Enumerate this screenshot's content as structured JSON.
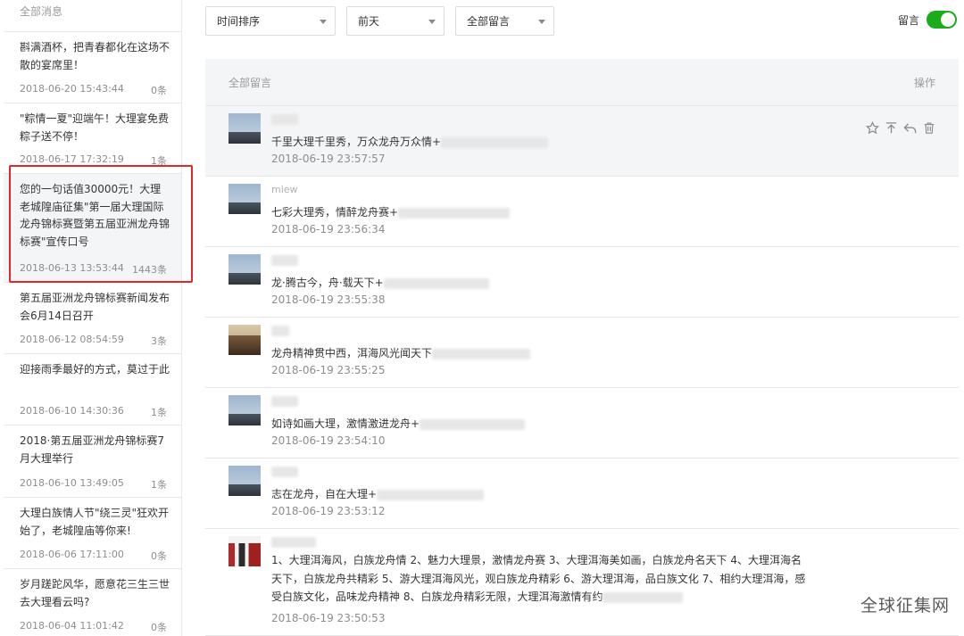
{
  "sidebar": {
    "header": "全部消息",
    "articles": [
      {
        "title": "斟满酒杯，把青春都化在这场不散的宴席里！",
        "date": "2018-06-20 15:43:44",
        "count": "0条"
      },
      {
        "title": "\"粽情一夏\"迎端午！大理宴免费粽子送不停！",
        "date": "2018-06-17 17:32:19",
        "count": "1条"
      },
      {
        "title": "您的一句话值30000元！大理老城隍庙征集\"第一届大理国际龙舟锦标赛暨第五届亚洲龙舟锦标赛\"宣传口号",
        "date": "2018-06-13 13:53:44",
        "count": "1443条"
      },
      {
        "title": "第五届亚洲龙舟锦标赛新闻发布会6月14日召开",
        "date": "2018-06-12 08:54:59",
        "count": "3条"
      },
      {
        "title": "迎接雨季最好的方式，莫过于此",
        "date": "2018-06-10 14:30:36",
        "count": "1条"
      },
      {
        "title": "2018·第五届亚洲龙舟锦标赛7月大理举行",
        "date": "2018-06-10 13:49:05",
        "count": "1条"
      },
      {
        "title": "大理白族情人节\"绕三灵\"狂欢开始了，老城隍庙等你来!",
        "date": "2018-06-06 17:11:00",
        "count": "0条"
      },
      {
        "title": "岁月蹉跎风华，愿意花三生三世去大理看云吗?",
        "date": "2018-06-04 11:01:42",
        "count": "0条"
      }
    ]
  },
  "toolbar": {
    "sort_select": "时间排序",
    "date_select": "前天",
    "filter_select": "全部留言",
    "toggle_label": "留言",
    "toggle_on": true
  },
  "panel": {
    "header_title": "全部留言",
    "header_action": "操作"
  },
  "comments": [
    {
      "nick": "",
      "text": "千里大理千里秀，万众龙舟万众情+",
      "time": "2018-06-19 23:57:57"
    },
    {
      "nick": "miew",
      "text": "七彩大理秀，情醉龙舟赛+",
      "time": "2018-06-19 23:56:34"
    },
    {
      "nick": "",
      "text": "龙·腾古今，舟·载天下+",
      "time": "2018-06-19 23:55:38"
    },
    {
      "nick": "",
      "text": "龙舟精神贯中西，洱海风光闻天下",
      "time": "2018-06-19 23:55:25"
    },
    {
      "nick": "",
      "text": "如诗如画大理，激情激进龙舟+",
      "time": "2018-06-19 23:54:10"
    },
    {
      "nick": "",
      "text": "志在龙舟，自在大理+",
      "time": "2018-06-19 23:53:12"
    },
    {
      "nick": "",
      "text": "1、大理洱海风，白族龙舟情 2、魅力大理景，激情龙舟赛 3、大理洱海美如画，白族龙舟名天下 4、大理洱海名天下，白族龙舟共精彩 5、游大理洱海风光，观白族龙舟精彩 6、游大理洱海，品白族文化 7、相约大理洱海，感受白族文化，品味龙舟精神 8、白族龙舟精彩无限，大理洱海激情有约",
      "time": "2018-06-19 23:50:53"
    }
  ],
  "watermark": "全球征集网",
  "colors": {
    "accent_green": "#1aad19",
    "highlight_red": "#e0272a"
  }
}
